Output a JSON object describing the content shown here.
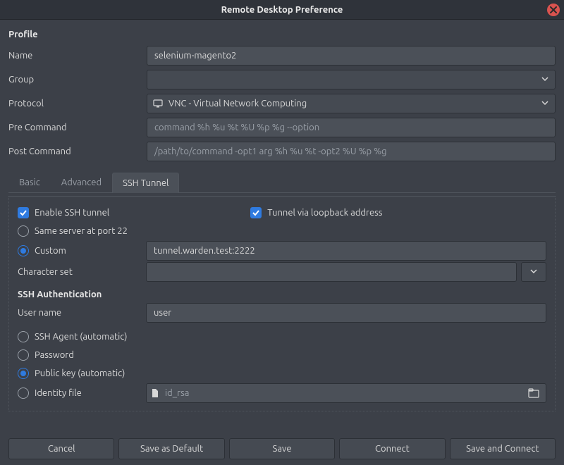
{
  "window": {
    "title": "Remote Desktop Preference"
  },
  "profile": {
    "section_label": "Profile",
    "name_label": "Name",
    "name_value": "selenium-magento2",
    "group_label": "Group",
    "group_value": "",
    "protocol_label": "Protocol",
    "protocol_value": "VNC - Virtual Network Computing",
    "pre_cmd_label": "Pre Command",
    "pre_cmd_placeholder": "command %h %u %t %U %p %g --option",
    "pre_cmd_value": "",
    "post_cmd_label": "Post Command",
    "post_cmd_placeholder": "/path/to/command -opt1 arg %h %u %t -opt2 %U %p %g",
    "post_cmd_value": ""
  },
  "tabs": {
    "basic": "Basic",
    "advanced": "Advanced",
    "ssh": "SSH Tunnel",
    "active": "ssh"
  },
  "ssh": {
    "enable_label": "Enable SSH tunnel",
    "enable_checked": true,
    "loopback_label": "Tunnel via loopback address",
    "loopback_checked": true,
    "same_server_label": "Same server at port 22",
    "same_server_selected": false,
    "custom_label": "Custom",
    "custom_selected": true,
    "custom_value": "tunnel.warden.test:2222",
    "charset_label": "Character set",
    "charset_value": "",
    "auth_section_label": "SSH Authentication",
    "username_label": "User name",
    "username_value": "user",
    "ssh_agent_label": "SSH Agent (automatic)",
    "ssh_agent_selected": false,
    "password_label": "Password",
    "password_selected": false,
    "pubkey_label": "Public key (automatic)",
    "pubkey_selected": true,
    "identity_label": "Identity file",
    "identity_selected": false,
    "identity_placeholder": "id_rsa",
    "identity_value": ""
  },
  "buttons": {
    "cancel": "Cancel",
    "save_default": "Save as Default",
    "save": "Save",
    "connect": "Connect",
    "save_connect": "Save and Connect"
  }
}
